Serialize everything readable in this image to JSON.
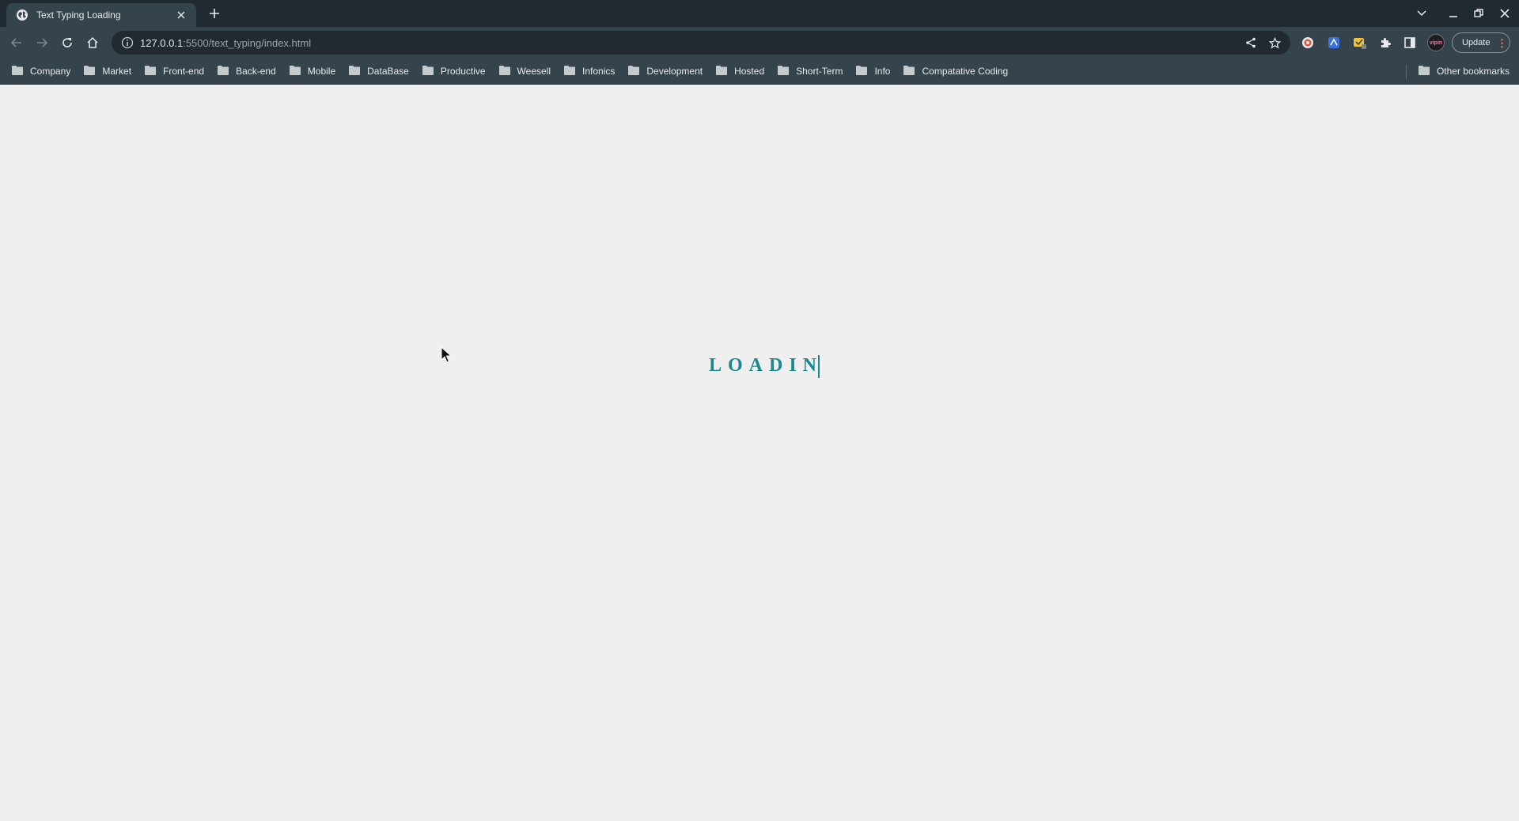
{
  "tab": {
    "title": "Text Typing Loading",
    "favicon": "globe-icon"
  },
  "toolbar": {
    "url_host": "127.0.0.1",
    "url_path": ":5500/text_typing/index.html",
    "update_label": "Update",
    "profile_initials": "vipin"
  },
  "bookmarks": {
    "items": [
      {
        "label": "Company"
      },
      {
        "label": "Market"
      },
      {
        "label": "Front-end"
      },
      {
        "label": "Back-end"
      },
      {
        "label": "Mobile"
      },
      {
        "label": "DataBase"
      },
      {
        "label": "Productive"
      },
      {
        "label": "Weesell"
      },
      {
        "label": "Infonics"
      },
      {
        "label": "Development"
      },
      {
        "label": "Hosted"
      },
      {
        "label": "Short-Term"
      },
      {
        "label": "Info"
      },
      {
        "label": "Compatative Coding"
      }
    ],
    "other_label": "Other bookmarks"
  },
  "page": {
    "loading_text": "LOADIN"
  },
  "colors": {
    "accent": "#17898f",
    "chrome_dark": "#202a30",
    "chrome_mid": "#35444c",
    "page_bg": "#efefef"
  }
}
